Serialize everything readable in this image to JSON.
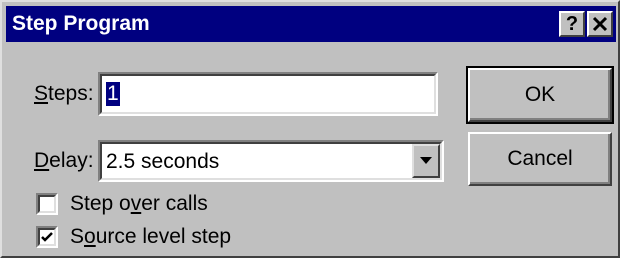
{
  "window": {
    "title": "Step Program",
    "help_label": "?",
    "close_label": "✕"
  },
  "steps": {
    "label_accel": "S",
    "label_rest": "teps:",
    "value": "1"
  },
  "delay": {
    "label_accel": "D",
    "label_rest": "elay:",
    "selected": "2.5 seconds"
  },
  "buttons": {
    "ok": "OK",
    "cancel": "Cancel"
  },
  "options": {
    "step_over_pre": "Step o",
    "step_over_accel": "v",
    "step_over_post": "er calls",
    "step_over_checked": false,
    "source_pre": "S",
    "source_accel": "o",
    "source_post": "urce level step",
    "source_checked": true
  },
  "icons": {
    "dropdown": "chevron-down-icon",
    "checkmark": "checkmark-icon"
  }
}
